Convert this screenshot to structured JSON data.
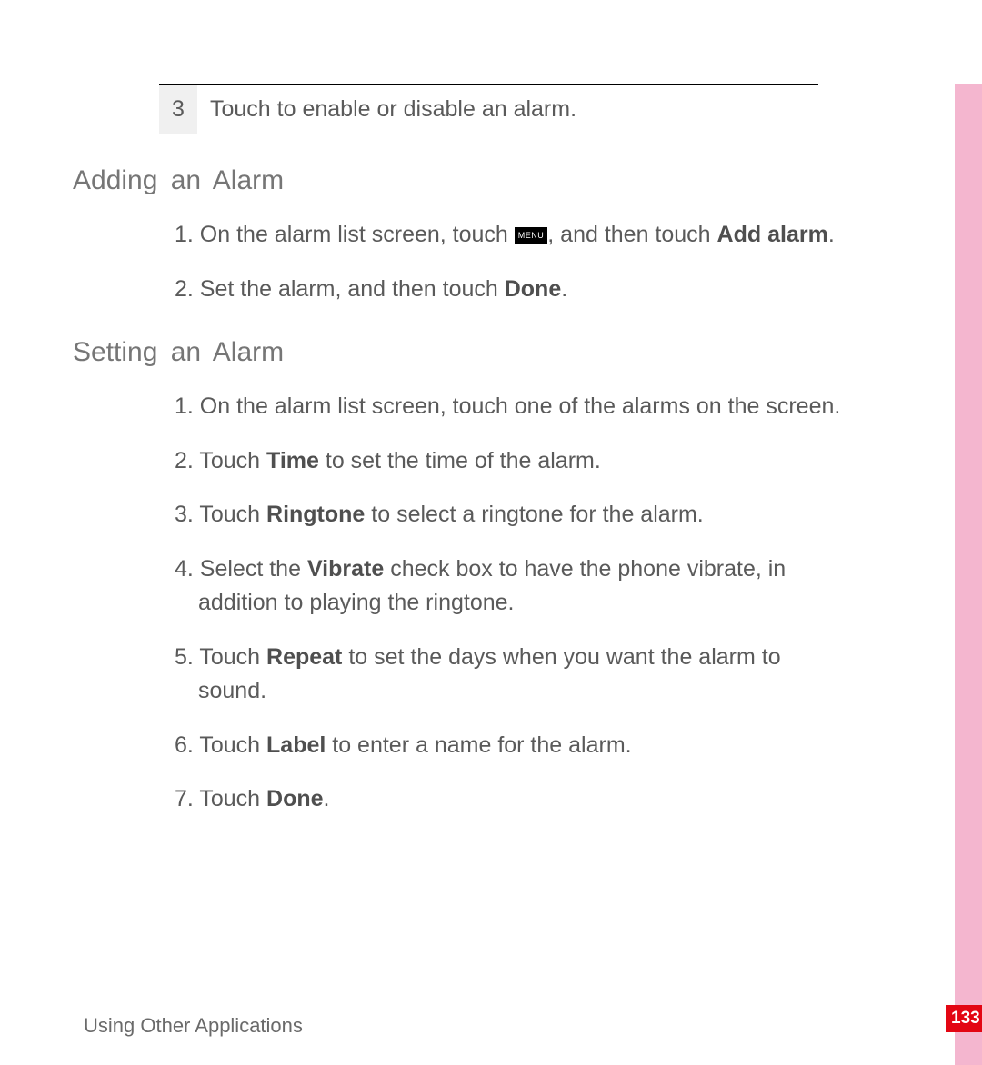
{
  "table": {
    "num": "3",
    "text": "Touch to enable or disable an alarm."
  },
  "sections": [
    {
      "heading": "Adding an Alarm",
      "items": [
        {
          "prefix": "1. ",
          "runs": [
            {
              "t": "On the alarm list screen, touch "
            },
            {
              "icon": "MENU"
            },
            {
              "t": ", and then touch "
            },
            {
              "t": "Add alarm",
              "b": true
            },
            {
              "t": "."
            }
          ]
        },
        {
          "prefix": "2. ",
          "runs": [
            {
              "t": "Set the alarm, and then touch "
            },
            {
              "t": "Done",
              "b": true
            },
            {
              "t": "."
            }
          ]
        }
      ]
    },
    {
      "heading": "Setting an Alarm",
      "items": [
        {
          "prefix": "1. ",
          "runs": [
            {
              "t": "On the alarm list screen, touch one of the alarms on the screen."
            }
          ]
        },
        {
          "prefix": "2. ",
          "runs": [
            {
              "t": "Touch "
            },
            {
              "t": "Time",
              "b": true
            },
            {
              "t": " to set the time of the alarm."
            }
          ]
        },
        {
          "prefix": "3. ",
          "runs": [
            {
              "t": "Touch "
            },
            {
              "t": "Ringtone",
              "b": true
            },
            {
              "t": " to select a ringtone for the alarm."
            }
          ]
        },
        {
          "prefix": "4. ",
          "runs": [
            {
              "t": "Select the "
            },
            {
              "t": "Vibrate",
              "b": true
            },
            {
              "t": " check box to have the phone vibrate, in addition to playing the ringtone."
            }
          ]
        },
        {
          "prefix": "5. ",
          "runs": [
            {
              "t": "Touch "
            },
            {
              "t": "Repeat",
              "b": true
            },
            {
              "t": " to set the days when you want the alarm to sound."
            }
          ]
        },
        {
          "prefix": "6. ",
          "runs": [
            {
              "t": "Touch "
            },
            {
              "t": "Label",
              "b": true
            },
            {
              "t": " to enter a name for the alarm."
            }
          ]
        },
        {
          "prefix": "7. ",
          "runs": [
            {
              "t": "Touch "
            },
            {
              "t": "Done",
              "b": true
            },
            {
              "t": "."
            }
          ]
        }
      ]
    }
  ],
  "footer": "Using Other Applications",
  "page_number": "133"
}
